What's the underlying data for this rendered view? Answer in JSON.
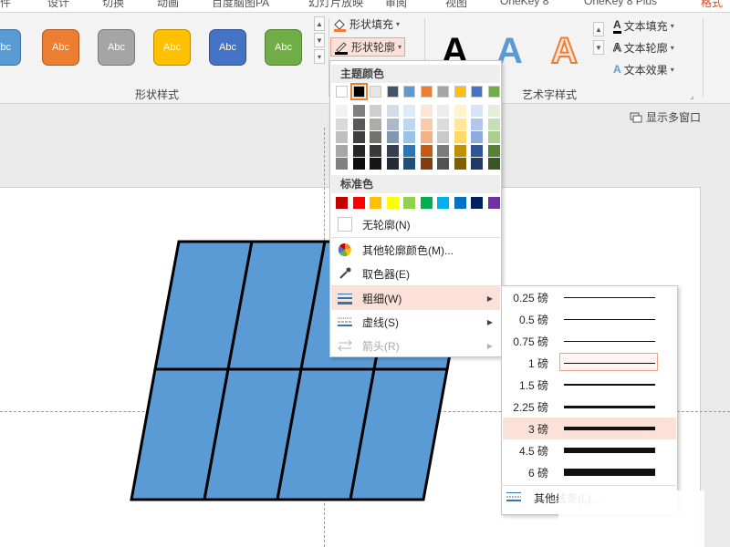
{
  "ribbon": {
    "tabs": [
      "文件",
      "设计",
      "切换",
      "动画",
      "百度脑图PA",
      "幻灯片放映",
      "审阅",
      "视图",
      "OneKey 8",
      "OneKey 8 Plus",
      "格式"
    ],
    "shape_styles": [
      {
        "label": "Abc",
        "color": "#5b9bd5"
      },
      {
        "label": "Abc",
        "color": "#ed7d31"
      },
      {
        "label": "Abc",
        "color": "#a5a5a5"
      },
      {
        "label": "Abc",
        "color": "#ffc000"
      },
      {
        "label": "Abc",
        "color": "#4472c4"
      },
      {
        "label": "Abc",
        "color": "#70ad47"
      }
    ],
    "shape_fill_label": "形状填充",
    "shape_outline_label": "形状轮廓",
    "shape_styles_group": "形状样式",
    "wordart_group": "艺术字样式",
    "text_fill_label": "文本填充",
    "text_outline_label": "文本轮廓",
    "text_effect_label": "文本效果",
    "wordart_letter": "A"
  },
  "canvas": {
    "show_multi_window": "显示多窗口"
  },
  "outline_menu": {
    "theme_colors_header": "主题颜色",
    "theme_colors": [
      "#ffffff",
      "#000000",
      "#e7e6e6",
      "#44546a",
      "#5b9bd5",
      "#ed7d31",
      "#a5a5a5",
      "#ffc000",
      "#4472c4",
      "#70ad47"
    ],
    "theme_shades": [
      [
        "#f2f2f2",
        "#d9d9d9",
        "#bfbfbf",
        "#a6a6a6",
        "#808080"
      ],
      [
        "#7f7f7f",
        "#595959",
        "#404040",
        "#262626",
        "#0d0d0d"
      ],
      [
        "#d0cece",
        "#aeabab",
        "#757171",
        "#3a3838",
        "#171616"
      ],
      [
        "#d6dce5",
        "#adb9ca",
        "#8497b0",
        "#333f50",
        "#222a35"
      ],
      [
        "#ddebf7",
        "#bdd7ee",
        "#9cc3e6",
        "#2e75b6",
        "#1f4e79"
      ],
      [
        "#fbe5d6",
        "#f8cbad",
        "#f4b183",
        "#c55a11",
        "#843c0c"
      ],
      [
        "#ededed",
        "#dbdbdb",
        "#c9c9c9",
        "#7b7b7b",
        "#525252"
      ],
      [
        "#fff2cc",
        "#ffe699",
        "#ffd966",
        "#bf9000",
        "#7f6000"
      ],
      [
        "#dae3f3",
        "#b4c7e7",
        "#8faadc",
        "#2f5597",
        "#203864"
      ],
      [
        "#e2f0d9",
        "#c5e0b4",
        "#a9d18e",
        "#548235",
        "#385723"
      ]
    ],
    "standard_colors_header": "标准色",
    "standard_colors": [
      "#c00000",
      "#ff0000",
      "#ffc000",
      "#ffff00",
      "#92d050",
      "#00b050",
      "#00b0f0",
      "#0070c0",
      "#002060",
      "#7030a0"
    ],
    "no_outline": "无轮廓(N)",
    "more_colors": "其他轮廓颜色(M)...",
    "eyedropper": "取色器(E)",
    "weight": "粗细(W)",
    "dashes": "虚线(S)",
    "arrows": "箭头(R)"
  },
  "weight_menu": {
    "items": [
      {
        "label": "0.25 磅",
        "pt": 0.25
      },
      {
        "label": "0.5 磅",
        "pt": 0.5
      },
      {
        "label": "0.75 磅",
        "pt": 0.75
      },
      {
        "label": "1 磅",
        "pt": 1
      },
      {
        "label": "1.5 磅",
        "pt": 1.5
      },
      {
        "label": "2.25 磅",
        "pt": 2.25
      },
      {
        "label": "3 磅",
        "pt": 3
      },
      {
        "label": "4.5 磅",
        "pt": 4.5
      },
      {
        "label": "6 磅",
        "pt": 6
      }
    ],
    "selected_index": 3,
    "hovered_index": 6,
    "more_lines": "其他线条(L)..."
  },
  "shape": {
    "fill_color": "#5b9bd5",
    "outline_color": "#000000"
  }
}
